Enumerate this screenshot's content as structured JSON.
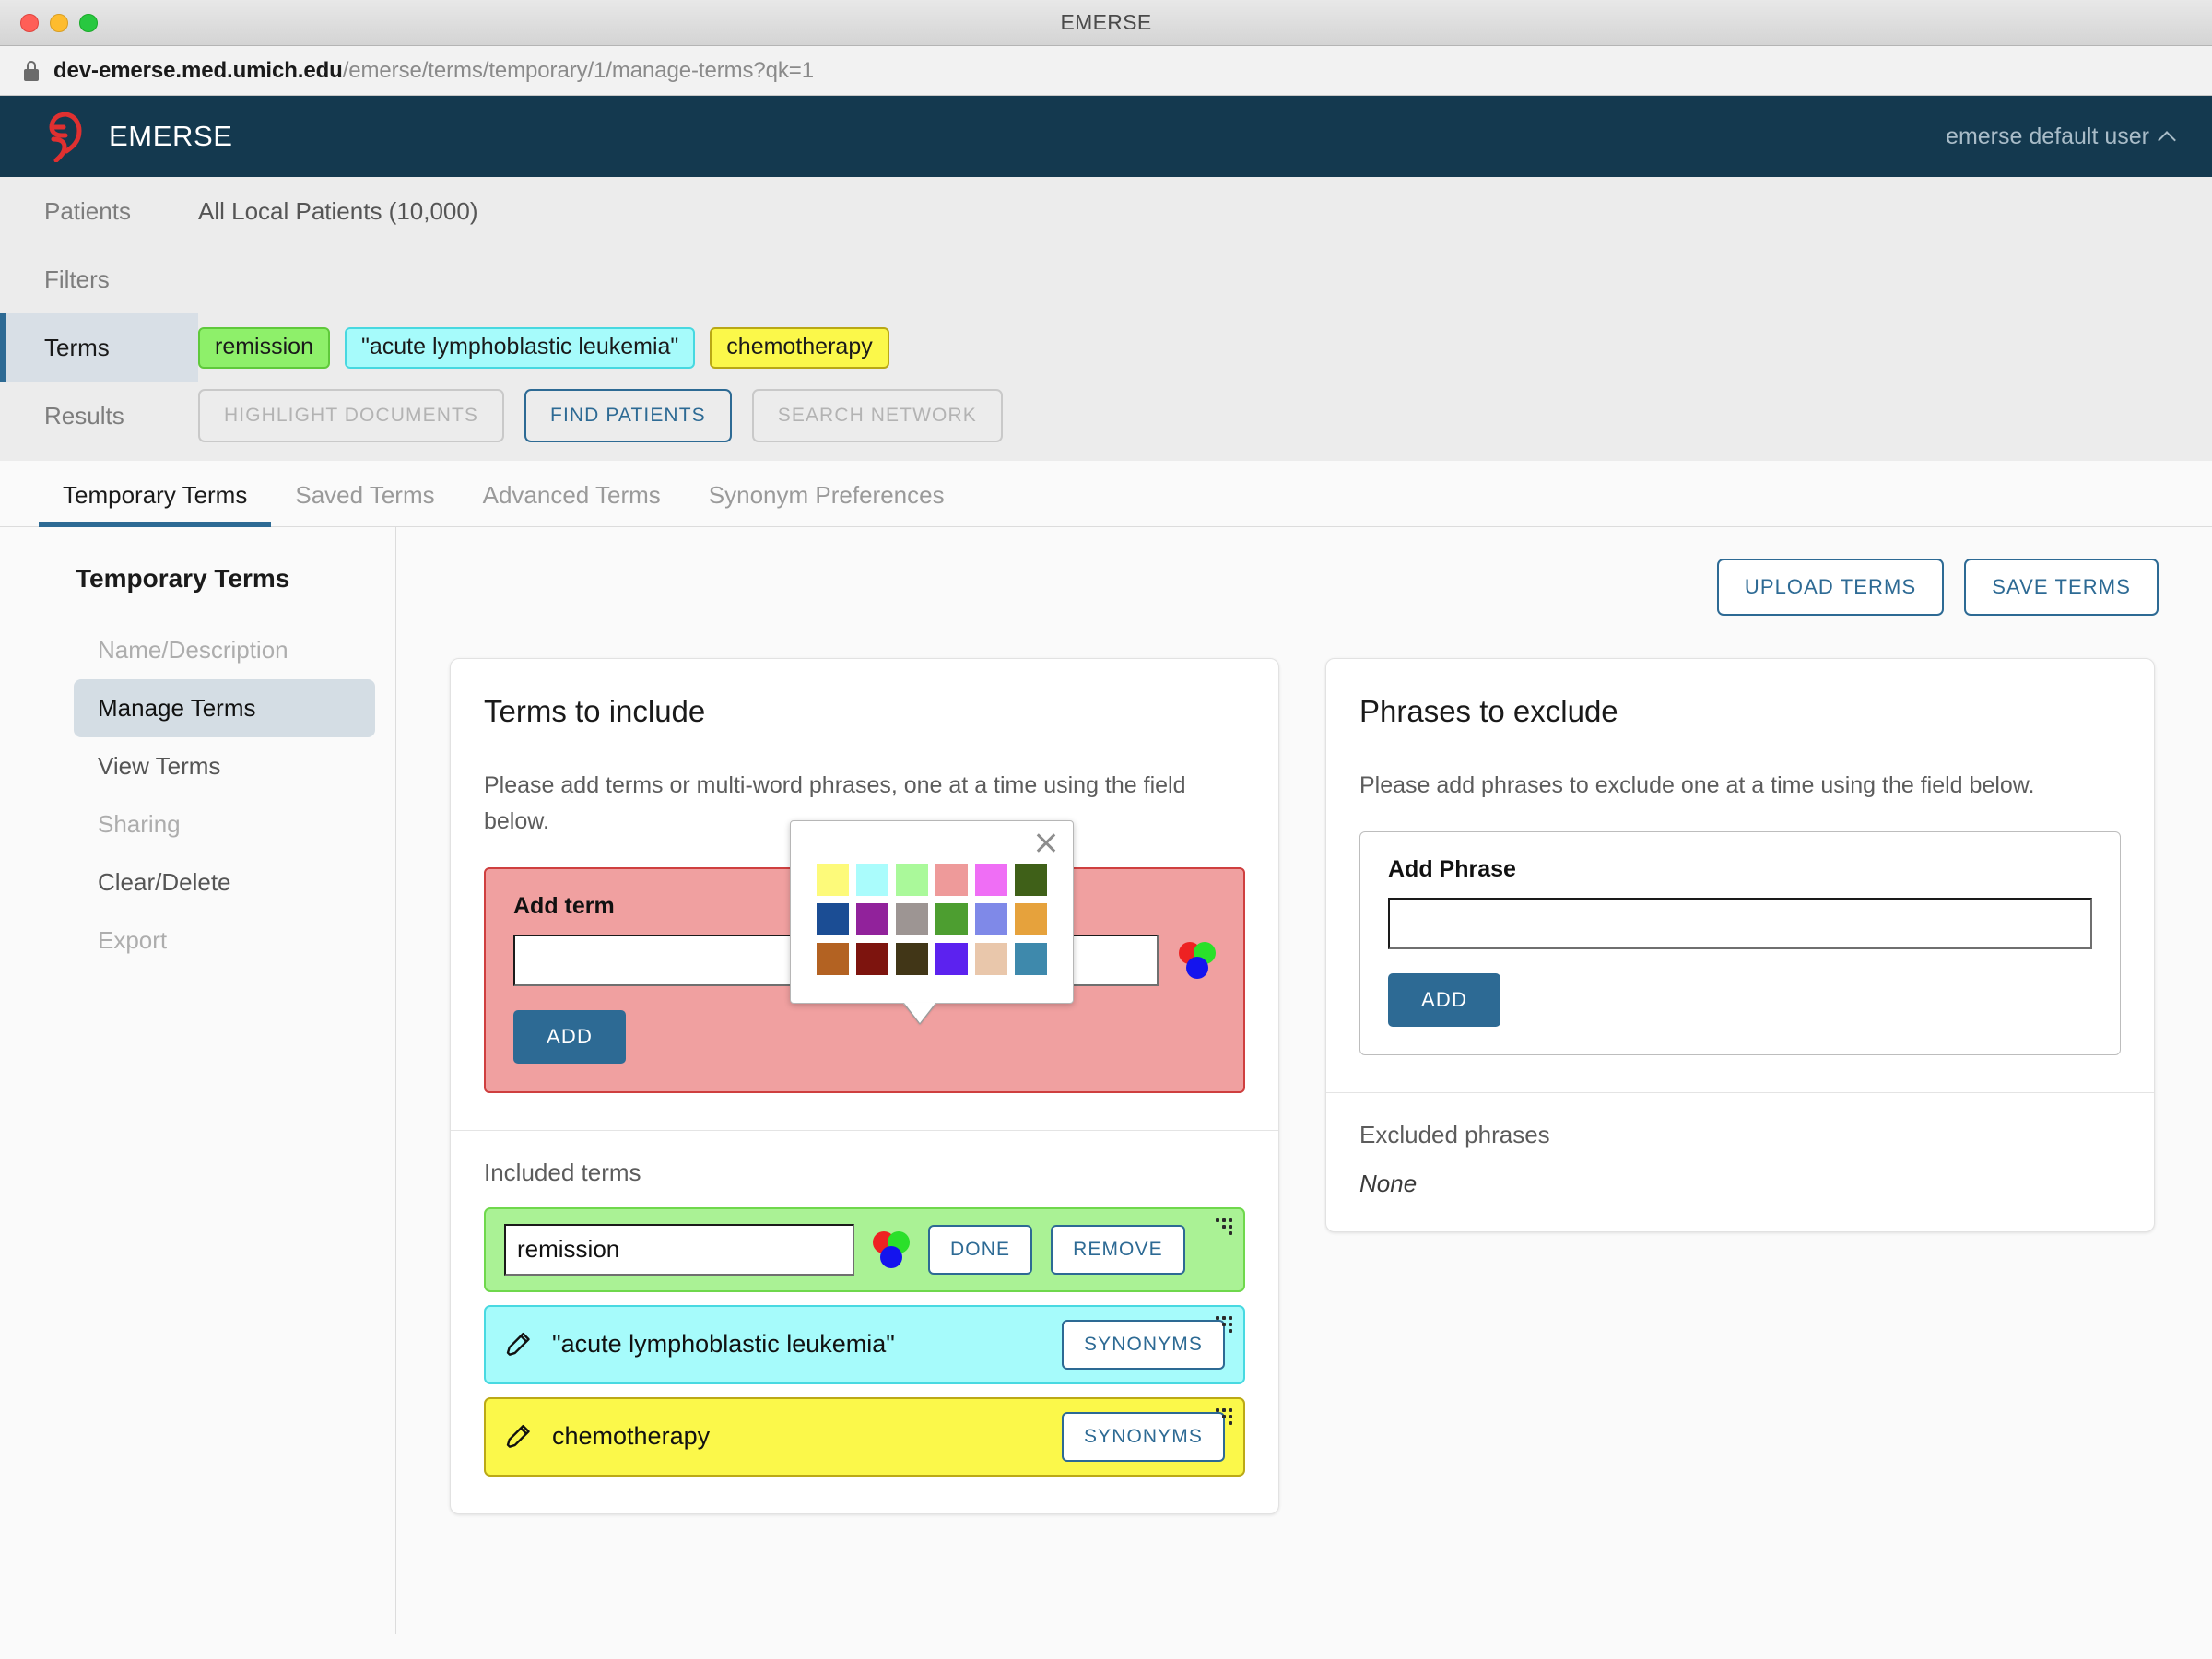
{
  "window": {
    "title": "EMERSE",
    "traffic_lights": [
      "close",
      "minimize",
      "zoom"
    ]
  },
  "browser": {
    "url_host": "dev-emerse.med.umich.edu",
    "url_path": "/emerse/terms/temporary/1/manage-terms?qk=1",
    "lock_icon": "lock-icon"
  },
  "appheader": {
    "brand": "EMERSE",
    "user": "emerse default user",
    "chevron": "chevron-up-icon"
  },
  "querybar": {
    "rows": [
      {
        "label": "Patients",
        "value": "All Local Patients (10,000)"
      },
      {
        "label": "Filters",
        "value": ""
      },
      {
        "label": "Terms",
        "value": ""
      },
      {
        "label": "Results",
        "value": ""
      }
    ],
    "chips": [
      {
        "text": "remission",
        "bg": "#8ef06a",
        "border": "#5fc93b"
      },
      {
        "text": "\"acute lymphoblastic leukemia\"",
        "bg": "#a6fbfb",
        "border": "#47d8e0"
      },
      {
        "text": "chemotherapy",
        "bg": "#fbf84a",
        "border": "#b9a815"
      }
    ],
    "actions": [
      {
        "label": "HIGHLIGHT DOCUMENTS",
        "state": "disabled"
      },
      {
        "label": "FIND PATIENTS",
        "state": "primary"
      },
      {
        "label": "SEARCH NETWORK",
        "state": "disabled"
      }
    ]
  },
  "tabs": [
    {
      "label": "Temporary Terms",
      "active": true
    },
    {
      "label": "Saved Terms",
      "active": false
    },
    {
      "label": "Advanced Terms",
      "active": false
    },
    {
      "label": "Synonym Preferences",
      "active": false
    }
  ],
  "sidebar": {
    "title": "Temporary Terms",
    "items": [
      {
        "label": "Name/Description",
        "state": "muted"
      },
      {
        "label": "Manage Terms",
        "state": "active"
      },
      {
        "label": "View Terms",
        "state": "normal"
      },
      {
        "label": "Sharing",
        "state": "muted"
      },
      {
        "label": "Clear/Delete",
        "state": "normal"
      },
      {
        "label": "Export",
        "state": "muted"
      }
    ]
  },
  "content_toolbar": {
    "upload_label": "UPLOAD TERMS",
    "save_label": "SAVE TERMS"
  },
  "include_card": {
    "title": "Terms to include",
    "help": "Please add terms or multi-word phrases, one at a time using the field below.",
    "add_label": "Add term",
    "add_value": "",
    "add_placeholder": "",
    "add_button": "ADD",
    "color_icon": "color-swatch-icon",
    "section_label": "Included terms",
    "terms": [
      {
        "text": "remission",
        "bg": "#aaf295",
        "border": "#6fd84c",
        "editing": true,
        "done_label": "DONE",
        "remove_label": "REMOVE"
      },
      {
        "text": "\"acute lymphoblastic leukemia\"",
        "bg": "#a6fbfb",
        "border": "#48d9e1",
        "editing": false,
        "synonyms_label": "SYNONYMS"
      },
      {
        "text": "chemotherapy",
        "bg": "#fbf84a",
        "border": "#bba916",
        "editing": false,
        "synonyms_label": "SYNONYMS"
      }
    ]
  },
  "exclude_card": {
    "title": "Phrases to exclude",
    "help": "Please add phrases to exclude one at a time using the field below.",
    "add_label": "Add Phrase",
    "add_value": "",
    "add_placeholder": "",
    "add_button": "ADD",
    "section_label": "Excluded phrases",
    "none_label": "None"
  },
  "color_popup": {
    "close_icon": "close-icon",
    "swatches": [
      "#fdfa7a",
      "#aafcfc",
      "#aaf99a",
      "#ee9a9a",
      "#ef6ef5",
      "#3f6018",
      "#1b4d94",
      "#91229b",
      "#9d9593",
      "#4d9e30",
      "#7f89e8",
      "#e6a23c",
      "#b36222",
      "#7d140e",
      "#413617",
      "#5c22ef",
      "#e9c7ab",
      "#3e89ac"
    ]
  }
}
